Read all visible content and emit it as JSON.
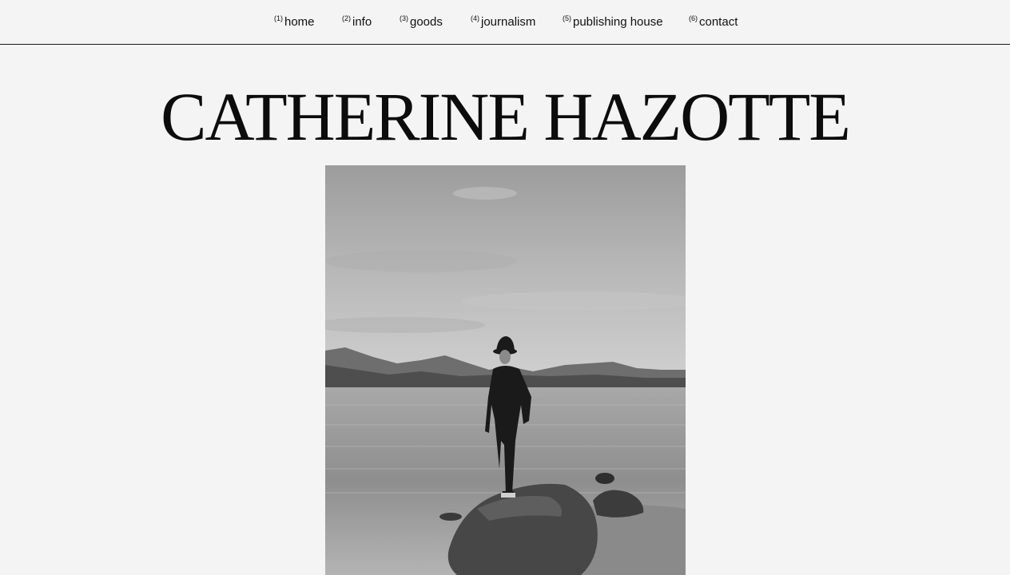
{
  "nav": {
    "items": [
      {
        "num": "(1)",
        "label": "home"
      },
      {
        "num": "(2)",
        "label": "info"
      },
      {
        "num": "(3)",
        "label": "goods"
      },
      {
        "num": "(4)",
        "label": "journalism"
      },
      {
        "num": "(5)",
        "label": "publishing house"
      },
      {
        "num": "(6)",
        "label": "contact"
      }
    ]
  },
  "header": {
    "title": "CATHERINE HAZOTTE"
  },
  "colors": {
    "background": "#f4f4f4",
    "text": "#111111",
    "divider": "#1a1a1a"
  }
}
